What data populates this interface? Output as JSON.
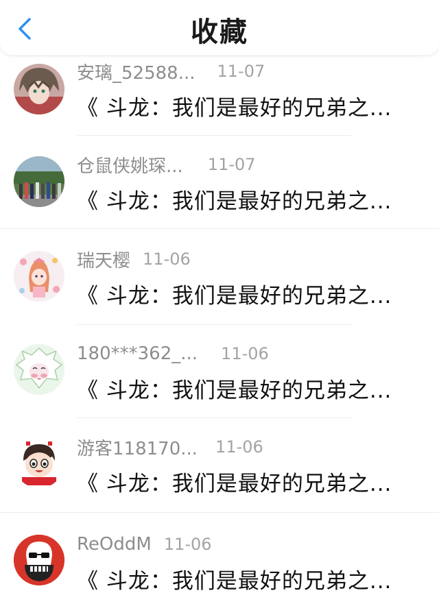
{
  "header": {
    "title": "收藏",
    "back_icon": "chevron-left-icon"
  },
  "colors": {
    "accent": "#2f8ff0",
    "title_text": "#1a1a1a",
    "meta_text": "#8d8d8d"
  },
  "favorites": [
    {
      "username": "安璃_52588...",
      "date": "11-07",
      "title": "《 斗龙：我们是最好的兄弟之...",
      "avatar": "anime-boy-avatar"
    },
    {
      "username": "仓鼠侠姚琛...",
      "date": "11-07",
      "title": "《 斗龙：我们是最好的兄弟之...",
      "avatar": "group-photo-avatar"
    },
    {
      "username": "瑞天樱",
      "date": "11-06",
      "title": "《 斗龙：我们是最好的兄弟之...",
      "avatar": "anime-girl-avatar"
    },
    {
      "username": "180***362_...",
      "date": "11-06",
      "title": "《 斗龙：我们是最好的兄弟之...",
      "avatar": "cartoon-creature-avatar"
    },
    {
      "username": "游客118170...",
      "date": "11-06",
      "title": "《 斗龙：我们是最好的兄弟之...",
      "avatar": "cartoon-boy-avatar"
    },
    {
      "username": "ReOddM",
      "date": "11-06",
      "title": "《 斗龙：我们是最好的兄弟之...",
      "avatar": "skull-avatar"
    }
  ]
}
